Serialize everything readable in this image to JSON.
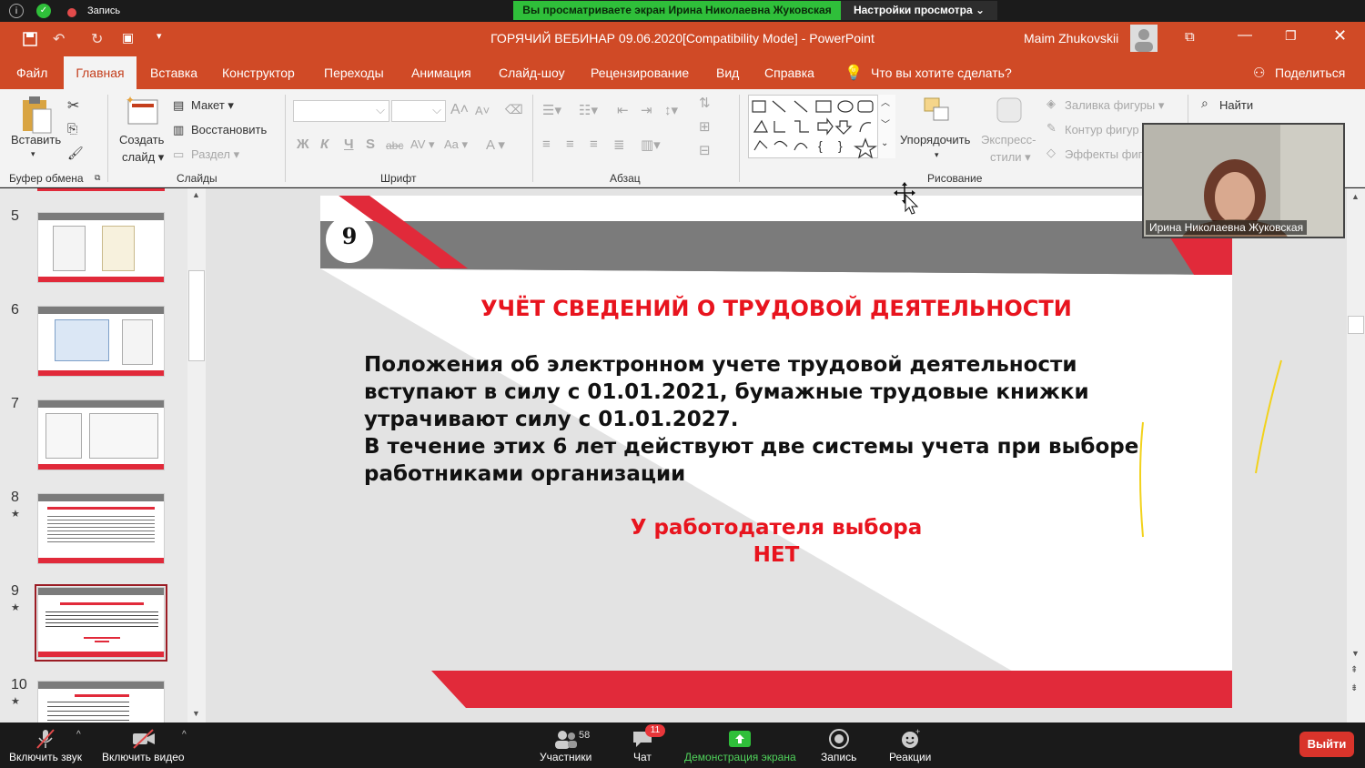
{
  "zoom": {
    "recording_label": "Запись",
    "share_banner": "Вы просматриваете экран Ирина Николаевна Жуковская",
    "view_options": "Настройки просмотра ⌄",
    "participants_count": "58",
    "chat_badge": "11",
    "bottom": {
      "mute": "Включить звук",
      "video": "Включить видео",
      "participants": "Участники",
      "chat": "Чат",
      "share": "Демонстрация экрана",
      "record": "Запись",
      "reactions": "Реакции",
      "leave": "Выйти"
    },
    "video_name": "Ирина Николаевна Жуковская"
  },
  "ppt": {
    "title": "ГОРЯЧИЙ ВЕБИНАР 09.06.2020[Compatibility Mode]  -  PowerPoint",
    "user": "Maim Zhukovskii",
    "menu": [
      "Файл",
      "Главная",
      "Вставка",
      "Конструктор",
      "Переходы",
      "Анимация",
      "Слайд-шоу",
      "Рецензирование",
      "Вид",
      "Справка"
    ],
    "tell_me": "Что вы хотите сделать?",
    "share": "Поделиться",
    "ribbon": {
      "paste": "Вставить",
      "clipboard": "Буфер обмена",
      "new_slide_1": "Создать",
      "new_slide_2": "слайд ▾",
      "layout": "Макет ▾",
      "reset": "Восстановить",
      "section": "Раздел ▾",
      "slides": "Слайды",
      "font": "Шрифт",
      "paragraph": "Абзац",
      "arrange": "Упорядочить",
      "quick_styles_1": "Экспресс-",
      "quick_styles_2": "стили ▾",
      "shape_fill": "Заливка фигуры ▾",
      "shape_outline": "Контур фигур",
      "shape_effects": "Эффекты фиг",
      "drawing": "Рисование",
      "find": "Найти",
      "font_buttons": [
        "Ж",
        "К",
        "Ч",
        "S",
        "abc",
        "AV ▾",
        "Aa ▾",
        "A ▾"
      ]
    },
    "thumbs": [
      {
        "num": "5",
        "star": ""
      },
      {
        "num": "6",
        "star": ""
      },
      {
        "num": "7",
        "star": ""
      },
      {
        "num": "8",
        "star": "★"
      },
      {
        "num": "9",
        "star": "★"
      },
      {
        "num": "10",
        "star": "★"
      }
    ]
  },
  "slide": {
    "number": "9",
    "title": "УЧЁТ СВЕДЕНИЙ О ТРУДОВОЙ ДЕЯТЕЛЬНОСТИ",
    "body_lines": [
      "Положения об электронном учете трудовой деятельности",
      "вступают в силу с 01.01.2021, бумажные трудовые книжки",
      "утрачивают силу с 01.01.2027.",
      "В течение этих 6 лет действуют две системы учета при выборе",
      "работниками организации"
    ],
    "highlight_1": "У работодателя выбора",
    "highlight_2": "НЕТ"
  },
  "colors": {
    "accent": "#d04a26",
    "slide_red": "#e12a3a",
    "slide_gray": "#7b7b7b",
    "zoom_green": "#2fbf3a"
  }
}
